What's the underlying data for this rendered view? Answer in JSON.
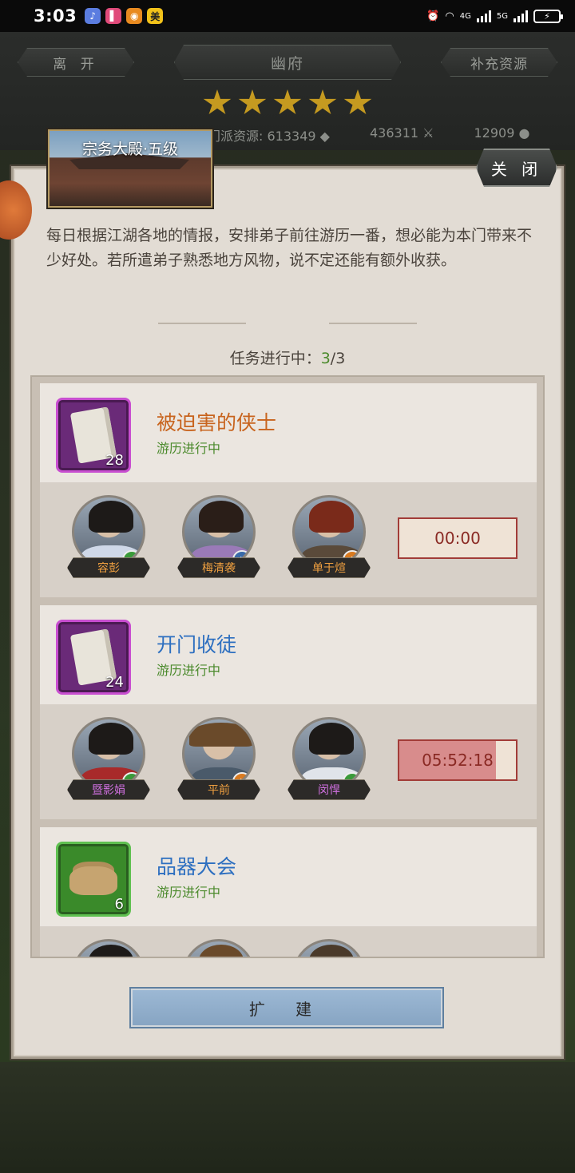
{
  "status_bar": {
    "time": "3:03",
    "apps": [
      {
        "icon": "music-app-icon",
        "glyph": "♪",
        "color": "#5b7de0"
      },
      {
        "icon": "book-app-icon",
        "glyph": "▌",
        "color": "#e04a7a"
      },
      {
        "icon": "weibo-app-icon",
        "glyph": "◉",
        "color": "#e88a20"
      },
      {
        "icon": "meituan-app-icon",
        "glyph": "美",
        "color": "#f2c21a"
      }
    ],
    "network_1": "4G",
    "network_2": "5G"
  },
  "top_bar": {
    "leave_label": "离 开",
    "location_label": "幽府",
    "replenish_label": "补充资源",
    "stars": 5,
    "resources": {
      "sect_label": "门派资源:",
      "sect_value": "613349",
      "second_value": "436311",
      "third_value": "12909"
    }
  },
  "panel": {
    "building_title": "宗务大殿·五级",
    "close_label": "关 闭",
    "description": "每日根据江湖各地的情报，安排弟子前往游历一番，想必能为本门带来不少好处。若所遣弟子熟悉地方风物，说不定还能有额外收获。",
    "progress_label": "任务进行中：",
    "progress_current": "3",
    "progress_total": "/3",
    "build_label": "扩 建"
  },
  "missions": [
    {
      "title": "被迫害的侠士",
      "title_color": "#c8641e",
      "status": "游历进行中",
      "item_icon": "scroll-icon",
      "item_count": "28",
      "timer": "00:00",
      "timer_progress": 0,
      "heroes": [
        {
          "name": "容彭",
          "name_color": "#f0a040",
          "badge": "sword-badge-icon",
          "badge_color": "#3a9a3a",
          "robe": "#cfd8e8",
          "hair": "#1d1a18"
        },
        {
          "name": "梅清袭",
          "name_color": "#f0a040",
          "badge": "blade-badge-icon",
          "badge_color": "#3a6aa8",
          "robe": "#9a7ab8",
          "hair": "#2a1e18"
        },
        {
          "name": "单于煊",
          "name_color": "#f0a040",
          "badge": "spear-badge-icon",
          "badge_color": "#d87a20",
          "robe": "#5a4a3a",
          "hair": "#7a2a1a"
        }
      ]
    },
    {
      "title": "开门收徒",
      "title_color": "#2d6fc0",
      "status": "游历进行中",
      "item_icon": "scroll-icon",
      "item_count": "24",
      "timer": "05:52:18",
      "timer_progress": 0.83,
      "heroes": [
        {
          "name": "暨影娟",
          "name_color": "#d070e0",
          "badge": "sword-badge-icon",
          "badge_color": "#3a9a3a",
          "robe": "#a82a2a",
          "hair": "#1d1a18"
        },
        {
          "name": "平前",
          "name_color": "#f0a040",
          "badge": "blade-badge-icon",
          "badge_color": "#d87a20",
          "robe": "#4a5a6a",
          "hair": "#6a4a2a"
        },
        {
          "name": "闵悍",
          "name_color": "#d070e0",
          "badge": "sword-badge-icon",
          "badge_color": "#3a9a3a",
          "robe": "#e0e4ea",
          "hair": "#1d1a18"
        }
      ]
    },
    {
      "title": "品器大会",
      "title_color": "#2d6fc0",
      "status": "游历进行中",
      "item_icon": "bag-icon",
      "item_count": "6"
    }
  ]
}
